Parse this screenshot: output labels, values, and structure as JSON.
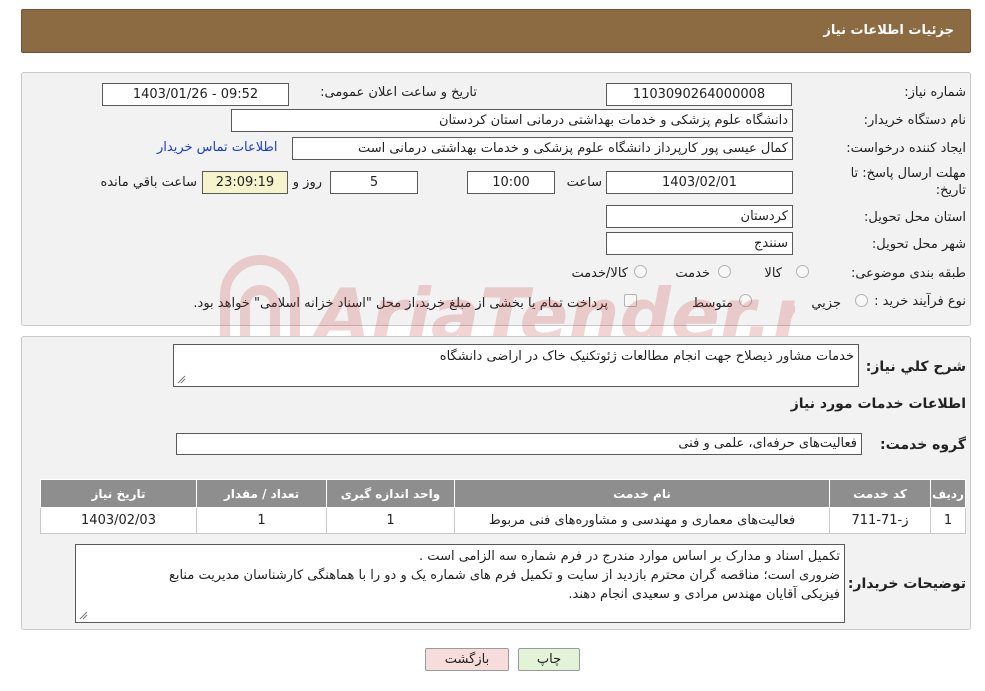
{
  "header": {
    "title": "جزئیات اطلاعات نیاز"
  },
  "form": {
    "need_number_label": "شماره نیاز:",
    "need_number": "1103090264000008",
    "announce_label": "تاریخ و ساعت اعلان عمومی:",
    "announce_value": "1403/01/26 - 09:52",
    "buyer_org_label": "نام دستگاه خریدار:",
    "buyer_org": "دانشگاه علوم پزشکی و خدمات بهداشتی  درمانی استان کردستان",
    "creator_label": "ایجاد کننده درخواست:",
    "creator": "کمال عیسی پور کارپرداز دانشگاه علوم پزشکی و خدمات بهداشتی  درمانی است",
    "contact_link": "اطلاعات تماس خریدار",
    "deadline_label_1": "مهلت ارسال پاسخ: تا",
    "deadline_label_2": "تاریخ:",
    "deadline_date": "1403/02/01",
    "time_label": "ساعت",
    "deadline_time": "10:00",
    "days_value": "5",
    "days_label": "روز و",
    "remaining_time": "23:09:19",
    "remaining_label": "ساعت باقي مانده",
    "province_label": "استان محل تحویل:",
    "province": "کردستان",
    "city_label": "شهر محل تحویل:",
    "city": "سنندج",
    "category_label": "طبقه بندی موضوعی:",
    "category_options": [
      "کالا",
      "خدمت",
      "کالا/خدمت"
    ],
    "process_label": "نوع فرآیند خرید :",
    "process_options": [
      "جزیي",
      "متوسط"
    ],
    "payment_note": "پرداخت تمام یا بخشی از مبلغ خرید،از محل \"اسناد خزانه اسلامی\" خواهد بود."
  },
  "details": {
    "summary_label": "شرح كلي نياز:",
    "summary": "خدمات مشاور ذیصلاح جهت انجام مطالعات ژئوتکنیک خاک در اراضی دانشگاه",
    "services_heading": "اطلاعات خدمات مورد نياز",
    "group_label": "گروه خدمت:",
    "group_value": "فعالیت‌های حرفه‌ای، علمی و فنی",
    "table": {
      "headers": [
        "رديف",
        "کد خدمت",
        "نام خدمت",
        "واحد اندازه گیری",
        "تعداد / مقدار",
        "تاریخ نیاز"
      ],
      "rows": [
        [
          "1",
          "ز-71-711",
          "فعالیت‌های معماری و مهندسی و مشاوره‌های فنی مربوط",
          "1",
          "1",
          "1403/02/03"
        ]
      ]
    },
    "buyer_notes_label": "توضيحات خريدار:",
    "buyer_notes_lines": [
      "تکمیل اسناد و مدارک بر اساس موارد مندرج در فرم شماره سه الزامی است .",
      "ضروری است؛ مناقصه گران محترم بازدید از سایت و تکمیل فرم های شماره یک و دو را با هماهنگی کارشناسان مدیریت منابع",
      "فیزیکی آقایان مهندس مرادی و سعیدی انجام دهند."
    ]
  },
  "buttons": {
    "print": "چاپ",
    "back": "بازگشت"
  },
  "watermark": {
    "text": "AriaTender.net"
  },
  "colors": {
    "header": "#8c6b43",
    "table_header": "#8e8e8e",
    "back_button": "#f7dcdc",
    "print_button": "#e3f3d8",
    "link": "#1a3fcf"
  }
}
